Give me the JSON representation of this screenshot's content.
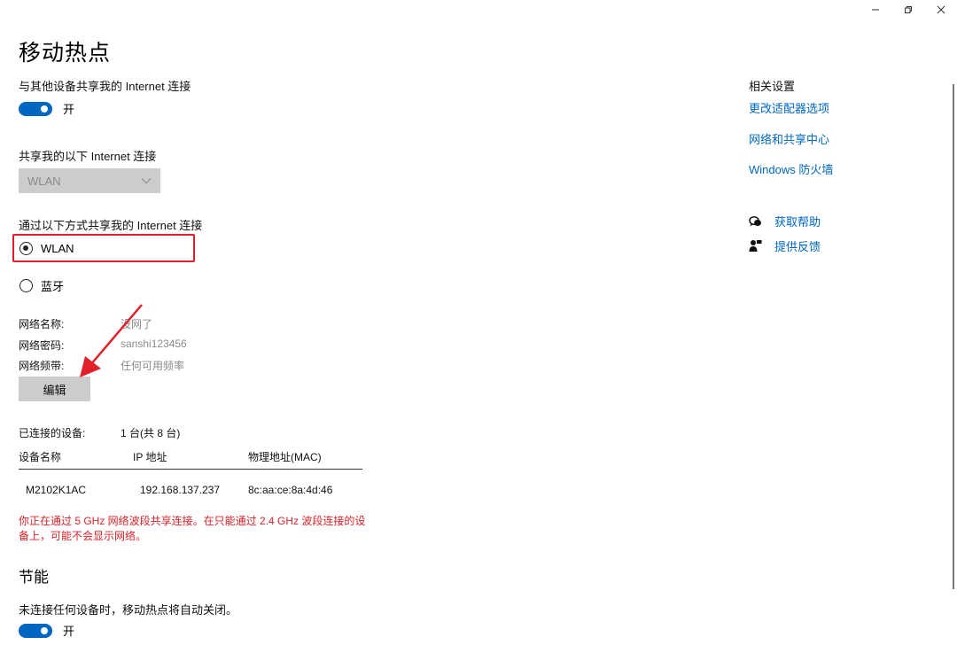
{
  "window": {
    "minimize_glyph": "–",
    "icons": [
      "minimize-icon",
      "restore-icon",
      "close-icon"
    ]
  },
  "page": {
    "title": "移动热点"
  },
  "share_internet": {
    "label": "与其他设备共享我的 Internet 连接",
    "toggle_state": "开",
    "toggle_on": true
  },
  "share_from": {
    "label": "共享我的以下 Internet 连接",
    "selected": "WLAN"
  },
  "share_over": {
    "label": "通过以下方式共享我的 Internet 连接",
    "options": [
      {
        "label": "WLAN",
        "checked": true
      },
      {
        "label": "蓝牙",
        "checked": false
      }
    ]
  },
  "network": {
    "name_key": "网络名称:",
    "name_value": "没网了",
    "password_key": "网络密码:",
    "password_value": "sanshi123456",
    "band_key": "网络频带:",
    "band_value": "任何可用频率",
    "edit_label": "编辑"
  },
  "devices": {
    "connected_key": "已连接的设备:",
    "connected_value": "1 台(共 8 台)",
    "columns": [
      "设备名称",
      "IP 地址",
      "物理地址(MAC)"
    ],
    "rows": [
      [
        "M2102K1AC",
        "192.168.137.237",
        "8c:aa:ce:8a:4d:46"
      ]
    ]
  },
  "warning": {
    "text": "你正在通过 5 GHz 网络波段共享连接。在只能通过 2.4 GHz 波段连接的设备上，可能不会显示网络。"
  },
  "power_saving": {
    "title": "节能",
    "label": "未连接任何设备时，移动热点将自动关闭。",
    "toggle_state": "开",
    "toggle_on": true
  },
  "related": {
    "title": "相关设置",
    "links": [
      "更改适配器选项",
      "网络和共享中心",
      "Windows 防火墙"
    ]
  },
  "help": {
    "get_help": "获取帮助",
    "feedback": "提供反馈"
  },
  "colors": {
    "accent": "#0067c0",
    "highlight_border": "#e0202a",
    "warning_text": "#d8232a",
    "annotation_arrow": "#e0202a"
  }
}
